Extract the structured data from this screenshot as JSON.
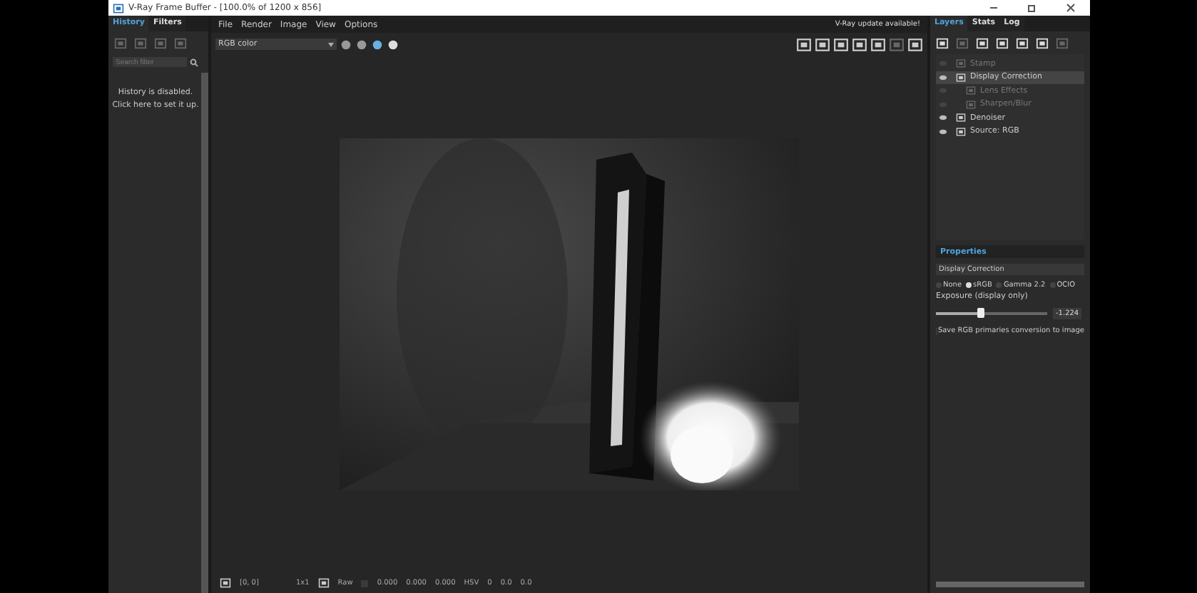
{
  "window": {
    "title": "V-Ray Frame Buffer - [100.0% of 1200 x 856]"
  },
  "left_panel": {
    "tabs": [
      {
        "label": "History",
        "selected": true
      },
      {
        "label": "Filters",
        "selected": false
      }
    ],
    "search": {
      "placeholder": "Search filter"
    },
    "message": [
      "History is disabled.",
      "Click here to set it up."
    ]
  },
  "menu": [
    "File",
    "Render",
    "Image",
    "View",
    "Options"
  ],
  "channel_select": {
    "value": "RGB color"
  },
  "update_notice": "V-Ray update available!",
  "right_panel": {
    "tabs": [
      {
        "label": "Layers",
        "selected": true
      },
      {
        "label": "Stats",
        "selected": false
      },
      {
        "label": "Log",
        "selected": false
      }
    ],
    "layers": [
      {
        "label": "Stamp",
        "visible": false,
        "selected": false
      },
      {
        "label": "Display Correction",
        "visible": true,
        "selected": true,
        "children": [
          {
            "label": "Lens Effects",
            "visible": false,
            "selected": false
          },
          {
            "label": "Sharpen/Blur",
            "visible": false,
            "selected": false
          }
        ]
      },
      {
        "label": "Denoiser",
        "visible": true,
        "selected": false
      },
      {
        "label": "Source: RGB",
        "visible": true,
        "selected": false
      }
    ],
    "properties": {
      "title": "Properties",
      "name": "Display Correction",
      "modes": [
        {
          "label": "None",
          "selected": false
        },
        {
          "label": "sRGB",
          "selected": true
        },
        {
          "label": "Gamma 2.2",
          "selected": false
        },
        {
          "label": "OCIO",
          "selected": false
        }
      ],
      "exposure": {
        "label": "Exposure (display only)",
        "level": 0.4,
        "reading": "-1.224"
      },
      "save_primaries": {
        "label": "Save RGB primaries conversion to image",
        "checked": false
      }
    }
  },
  "status_bar": {
    "coords": "[0, 0]",
    "zoom": "1x1",
    "mode": "Raw",
    "values": [
      "0.000",
      "0.000",
      "0.000"
    ],
    "color_space": "HSV",
    "readouts": [
      "0",
      "0.0",
      "0.0"
    ]
  }
}
